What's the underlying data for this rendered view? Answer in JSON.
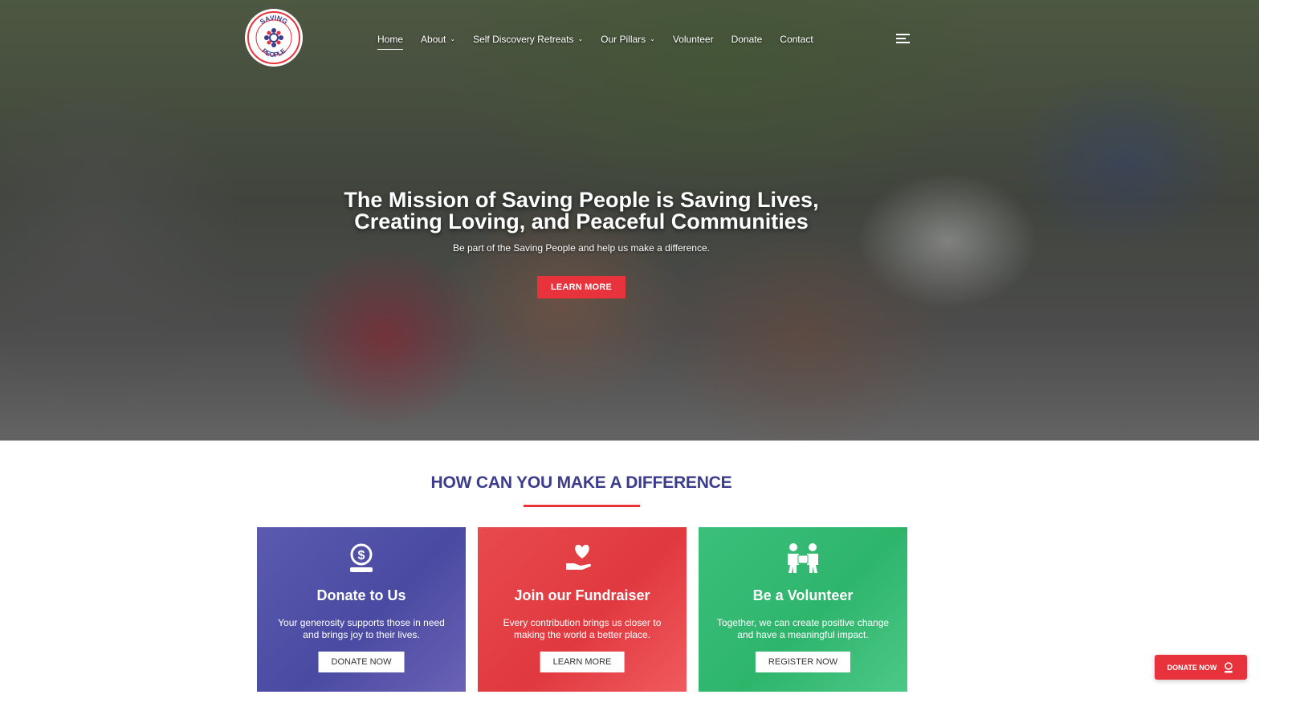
{
  "brand": {
    "logo_text_top": "SAVING",
    "logo_text_bottom": "PEOPLE"
  },
  "nav": {
    "items": [
      {
        "label": "Home",
        "active": true,
        "dropdown": false
      },
      {
        "label": "About",
        "active": false,
        "dropdown": true
      },
      {
        "label": "Self Discovery Retreats",
        "active": false,
        "dropdown": true
      },
      {
        "label": "Our Pillars",
        "active": false,
        "dropdown": true
      },
      {
        "label": "Volunteer",
        "active": false,
        "dropdown": false
      },
      {
        "label": "Donate",
        "active": false,
        "dropdown": false
      },
      {
        "label": "Contact",
        "active": false,
        "dropdown": false
      }
    ]
  },
  "hero": {
    "title_line1": "The Mission of Saving People is Saving Lives,",
    "title_line2": "Creating Loving, and Peaceful Communities",
    "subtitle": "Be part of the Saving People and help us make a difference.",
    "button": "LEARN MORE"
  },
  "section": {
    "title": "HOW CAN YOU MAKE A DIFFERENCE"
  },
  "cards": [
    {
      "icon": "donate-coin-icon",
      "title": "Donate to Us",
      "text": "Your generosity supports those in need and brings joy to their lives.",
      "button": "DONATE NOW",
      "color": "#4a4aa2"
    },
    {
      "icon": "heart-hand-icon",
      "title": "Join our Fundraiser",
      "text": "Every contribution brings us closer to making the world a better place.",
      "button": "LEARN MORE",
      "color": "#e0393f"
    },
    {
      "icon": "volunteers-icon",
      "title": "Be a Volunteer",
      "text": "Together, we can create positive change and have a meaningful impact.",
      "button": "REGISTER NOW",
      "color": "#2eb56c"
    }
  ],
  "floating": {
    "label": "DONATE NOW",
    "color": "#e8323c"
  },
  "colors": {
    "accent": "#e8323c",
    "heading": "#3c3c8c"
  }
}
